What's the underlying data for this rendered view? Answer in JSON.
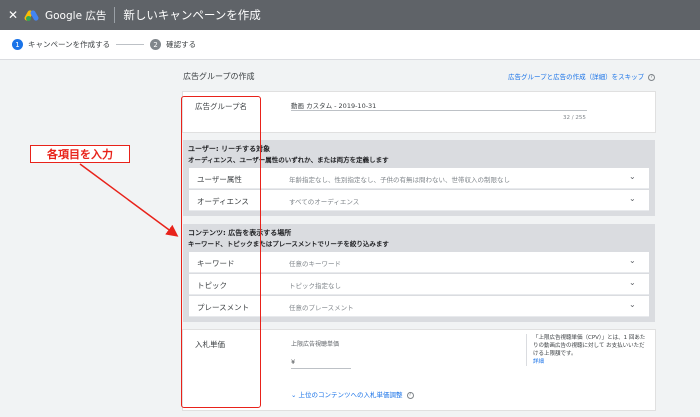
{
  "topbar": {
    "close": "✕",
    "brand": "Google 広告",
    "title": "新しいキャンペーンを作成"
  },
  "stepper": [
    {
      "num": "1",
      "label": "キャンペーンを作成する"
    },
    {
      "num": "2",
      "label": "確認する"
    }
  ],
  "section_title": "広告グループの作成",
  "skip_link": "広告グループと広告の作成（詳細）をスキップ",
  "ad_group": {
    "label": "広告グループ名",
    "value": "動画 カスタム - 2019-10-31",
    "count": "32 / 255"
  },
  "users": {
    "heading": "ユーザー: リーチする対象",
    "subheading": "オーディエンス、ユーザー属性のいずれか、または両方を定義します",
    "rows": [
      {
        "label": "ユーザー属性",
        "value": "年齢指定なし、性別指定なし、子供の有無は問わない、世帯収入の制限なし"
      },
      {
        "label": "オーディエンス",
        "value": "すべてのオーディエンス"
      }
    ]
  },
  "content": {
    "heading": "コンテンツ: 広告を表示する場所",
    "subheading": "キーワード、トピックまたはプレースメントでリーチを絞り込みます",
    "rows": [
      {
        "label": "キーワード",
        "value": "任意のキーワード"
      },
      {
        "label": "トピック",
        "value": "トピック指定なし"
      },
      {
        "label": "プレースメント",
        "value": "任意のプレースメント"
      }
    ]
  },
  "bid": {
    "label": "入札単価",
    "sub": "上限広告視聴単価",
    "currency": "¥",
    "description": "「上限広告視聴単価（CPV）」とは、1 回あたりの動画広告の視聴に対して お支払いいただける上限額です。",
    "detail_link": "詳細",
    "adjust": "上位のコンテンツへの入札単価調整"
  },
  "annotation": "各項目を入力",
  "colors": {
    "accent": "#1a73e8",
    "topbar": "#5f6368",
    "annotation": "#e8221a"
  }
}
